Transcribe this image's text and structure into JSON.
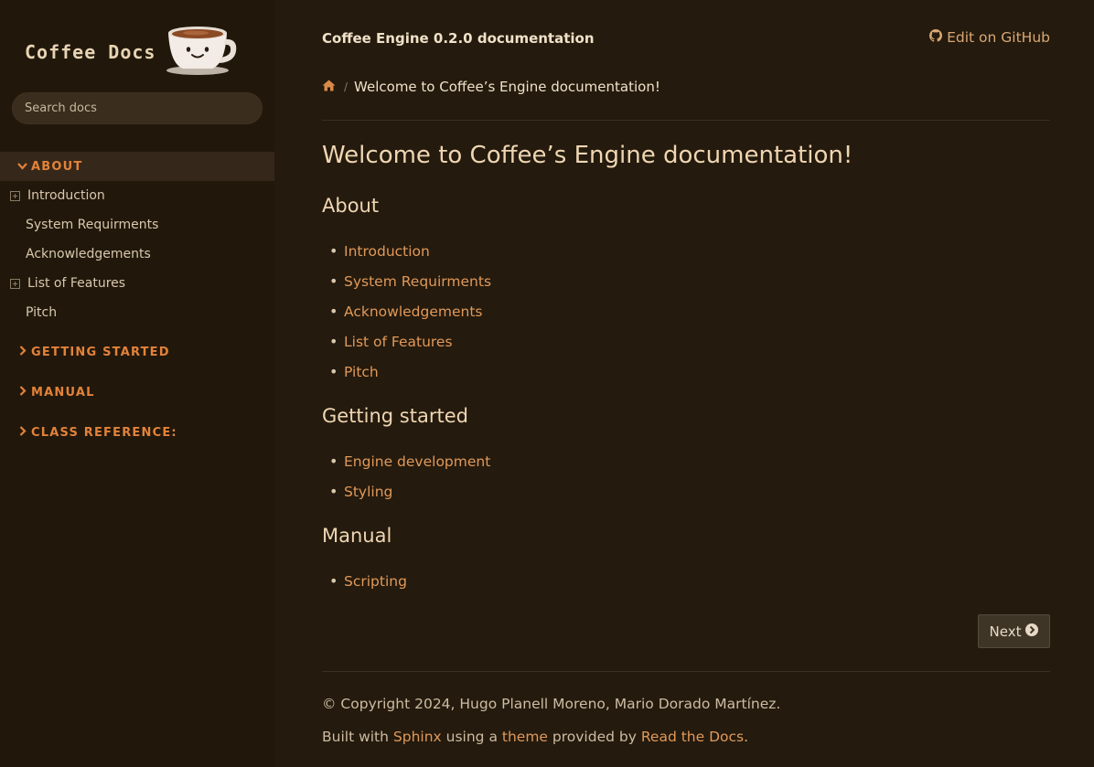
{
  "colors": {
    "background": "#241a0d",
    "sidebar": "#21180b",
    "accent": "#e3823a",
    "link": "#e0995a"
  },
  "sidebar": {
    "logo_text": "Coffee Docs",
    "logo_icon": "coffee-cup-icon",
    "search_placeholder": "Search docs",
    "sections": [
      {
        "caption": "ABOUT",
        "expanded": true,
        "items": [
          {
            "label": "Introduction",
            "expandable": true
          },
          {
            "label": "System Requirments",
            "expandable": false
          },
          {
            "label": "Acknowledgements",
            "expandable": false
          },
          {
            "label": "List of Features",
            "expandable": true
          },
          {
            "label": "Pitch",
            "expandable": false
          }
        ]
      },
      {
        "caption": "GETTING STARTED",
        "expanded": false
      },
      {
        "caption": "MANUAL",
        "expanded": false
      },
      {
        "caption": "CLASS REFERENCE:",
        "expanded": false
      }
    ]
  },
  "header": {
    "doc_title": "Coffee Engine 0.2.0 documentation",
    "edit_label": "Edit on GitHub",
    "breadcrumb_home_icon": "home-icon",
    "breadcrumb_sep": "/",
    "breadcrumb_current": "Welcome to Coffee’s Engine documentation!"
  },
  "content": {
    "title": "Welcome to Coffee’s Engine documentation!",
    "sections": [
      {
        "heading": "About",
        "links": [
          "Introduction",
          "System Requirments",
          "Acknowledgements",
          "List of Features",
          "Pitch"
        ]
      },
      {
        "heading": "Getting started",
        "links": [
          "Engine development",
          "Styling"
        ]
      },
      {
        "heading": "Manual",
        "links": [
          "Scripting"
        ]
      }
    ]
  },
  "navigation": {
    "next_label": "Next",
    "next_icon": "arrow-circle-right-icon"
  },
  "footer": {
    "copyright": "© Copyright 2024, Hugo Planell Moreno, Mario Dorado Martínez.",
    "built_prefix": "Built with",
    "built_sphinx": "Sphinx",
    "built_using": "using a",
    "built_theme": "theme",
    "built_provided": "provided by",
    "built_rtd": "Read the Docs",
    "built_end": "."
  }
}
